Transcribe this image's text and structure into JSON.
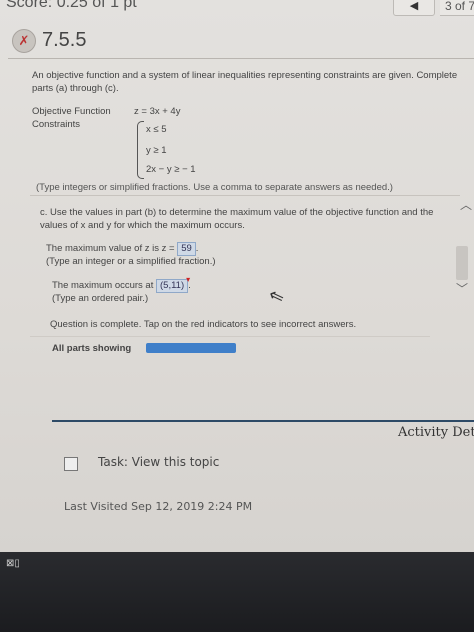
{
  "header": {
    "score": "Score: 0.25 of 1 pt",
    "prev_icon": "chevron-left-icon",
    "page_counter": "3 of 7"
  },
  "question": {
    "status_icon": "partially-correct-icon",
    "number": "7.5.5",
    "intro": "An objective function and a system of linear inequalities representing constraints are given. Complete parts (a) through (c).",
    "objective_label": "Objective Function",
    "objective": "z = 3x + 4y",
    "constraints_label": "Constraints",
    "constraints": [
      "x ≤ 5",
      "y ≥ 1",
      "2x − y ≥ − 1"
    ],
    "cut_line": "(Type integers or simplified fractions. Use a comma to separate answers as needed.)"
  },
  "part_c": {
    "instruction": "c. Use the values in part (b) to determine the maximum value of the objective function and the values of x and y for which the maximum occurs.",
    "max_value_label": "The maximum value of z is z =",
    "max_value": "59",
    "max_value_hint": "(Type an integer or a simplified fraction.)",
    "max_occurs_label": "The maximum occurs at",
    "max_occurs": "(5,11)",
    "max_occurs_hint": "(Type an ordered pair.)"
  },
  "status": {
    "complete_text": "Question is complete. Tap on the red indicators to see incorrect answers.",
    "all_parts_label": "All parts showing",
    "progress_fraction": 1.0
  },
  "footer": {
    "activity_label": "Activity Det",
    "task_label": "Task: View this topic",
    "last_visited": "Last Visited Sep 12, 2019 2:24 PM"
  },
  "colors": {
    "progress": "#3f7fc9",
    "answer_box": "#cfd9e6",
    "incorrect_indicator": "#cc2222",
    "divider": "#2d4a66"
  }
}
